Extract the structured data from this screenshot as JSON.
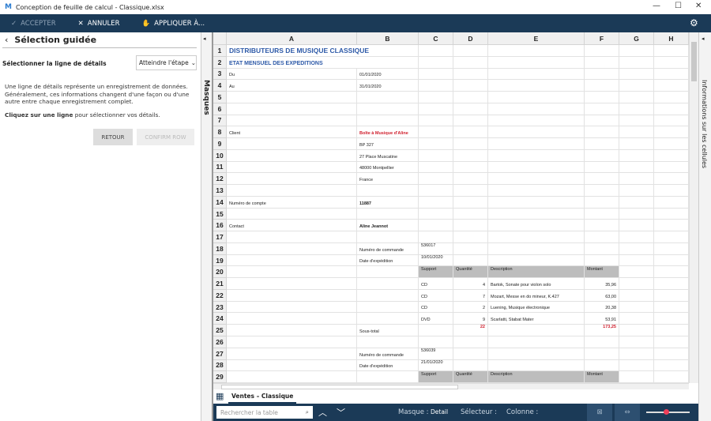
{
  "window": {
    "title": "Conception de feuille de calcul - Classique.xlsx",
    "logo": "M"
  },
  "toolbar": {
    "accept": "ACCEPTER",
    "cancel": "ANNULER",
    "apply": "APPLIQUER À..."
  },
  "left_panel": {
    "title": "Sélection guidée",
    "step_label": "Sélectionner la ligne de détails",
    "step_select": "Atteindre l'étape",
    "description": "Une ligne de détails représente un enregistrement de données. Généralement, ces informations changent d'une façon ou d'une autre entre chaque enregistrement complet.",
    "instruction_bold": "Cliquez sur une ligne",
    "instruction_rest": " pour sélectionner vos détails.",
    "back_button": "RETOUR",
    "confirm_button": "CONFIRM ROW"
  },
  "masques_label": "Masques",
  "right_panel_label": "Informations sur les cellules",
  "columns": [
    "A",
    "B",
    "C",
    "D",
    "E",
    "F",
    "G",
    "H"
  ],
  "rows": [
    {
      "n": "1",
      "cells": {
        "A": "DISTRIBUTEURS DE MUSIQUE CLASSIQUE"
      },
      "style": "title"
    },
    {
      "n": "2",
      "cells": {
        "A": "ETAT MENSUEL DES EXPEDITIONS"
      },
      "style": "subtitle"
    },
    {
      "n": "3",
      "cells": {
        "A": "Du",
        "B": "01/01/2020"
      }
    },
    {
      "n": "4",
      "cells": {
        "A": "Au",
        "B": "31/01/2020"
      }
    },
    {
      "n": "5",
      "cells": {}
    },
    {
      "n": "6",
      "cells": {}
    },
    {
      "n": "7",
      "cells": {}
    },
    {
      "n": "8",
      "cells": {
        "A": "Client",
        "B": "Boîte à Musique d'Aline"
      },
      "style": "client"
    },
    {
      "n": "9",
      "cells": {
        "B": "BP 327"
      }
    },
    {
      "n": "10",
      "cells": {
        "B": "27 Place Muscatine"
      }
    },
    {
      "n": "11",
      "cells": {
        "B": "48000 Montpellier"
      }
    },
    {
      "n": "12",
      "cells": {
        "B": "France"
      }
    },
    {
      "n": "13",
      "cells": {}
    },
    {
      "n": "14",
      "cells": {
        "A": "Numéro de compte",
        "B": "11887"
      },
      "style": "boldB"
    },
    {
      "n": "15",
      "cells": {}
    },
    {
      "n": "16",
      "cells": {
        "A": "Contact",
        "B": "Aline Jeannot"
      },
      "style": "boldB"
    },
    {
      "n": "17",
      "cells": {}
    },
    {
      "n": "18",
      "cells": {
        "B": "Numéro de commande",
        "C": "536017"
      }
    },
    {
      "n": "19",
      "cells": {
        "B": "Date d'expédition",
        "C": "10/01/2020"
      }
    },
    {
      "n": "20",
      "cells": {
        "C": "Support",
        "D": "Quantité",
        "E": "Description",
        "F": "Montant"
      },
      "style": "header"
    },
    {
      "n": "21",
      "cells": {
        "C": "CD",
        "D": "4",
        "E": "Bartok, Sonate pour violon solo",
        "F": "35,96"
      }
    },
    {
      "n": "22",
      "cells": {
        "C": "CD",
        "D": "7",
        "E": "Mozart, Messe en do mineur, K.427",
        "F": "63,00"
      }
    },
    {
      "n": "23",
      "cells": {
        "C": "CD",
        "D": "2",
        "E": "Luening, Musique électronique",
        "F": "20,38"
      }
    },
    {
      "n": "24",
      "cells": {
        "C": "DVD",
        "D": "9",
        "E": "Scarlatti, Stabat Mater",
        "F": "53,91"
      }
    },
    {
      "n": "25",
      "cells": {
        "B": "Sous-total",
        "D": "22",
        "F": "173,25"
      },
      "style": "total"
    },
    {
      "n": "26",
      "cells": {}
    },
    {
      "n": "27",
      "cells": {
        "B": "Numéro de commande",
        "C": "536039"
      }
    },
    {
      "n": "28",
      "cells": {
        "B": "Date d'expédition",
        "C": "21/01/2020"
      }
    },
    {
      "n": "29",
      "cells": {
        "C": "Support",
        "D": "Quantité",
        "E": "Description",
        "F": "Montant"
      },
      "style": "header"
    }
  ],
  "sheet_tab": "Ventes – Classique",
  "status": {
    "search_placeholder": "Rechercher la table",
    "masque_label": "Masque :",
    "masque_value": "Detail",
    "selecteur_label": "Sélecteur :",
    "colonne_label": "Colonne :"
  },
  "colors": {
    "toolbar": "#1b3a57",
    "title_blue": "#2e5aa8",
    "red": "#d0202e",
    "table_header": "#bdbdbd"
  }
}
